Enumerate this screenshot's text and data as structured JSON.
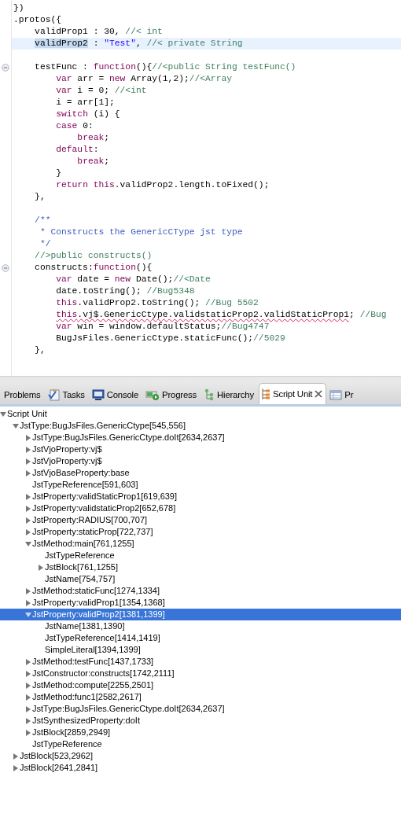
{
  "editor": {
    "lines": [
      {
        "kind": "flush",
        "fold": false,
        "highlighted": false,
        "tokens": [
          {
            "kind": "plain",
            "text": "})"
          }
        ]
      },
      {
        "kind": "flush",
        "fold": false,
        "highlighted": false,
        "tokens": [
          {
            "kind": "plain",
            "text": ".protos({"
          }
        ]
      },
      {
        "kind": "member",
        "fold": false,
        "highlighted": false,
        "tokens": [
          {
            "kind": "plain",
            "text": "validProp1 : 30, "
          },
          {
            "kind": "comment",
            "text": "//< int"
          }
        ]
      },
      {
        "kind": "member",
        "fold": false,
        "highlighted": true,
        "tokens": [
          {
            "kind": "selection",
            "text": "validProp2"
          },
          {
            "kind": "plain",
            "text": " : "
          },
          {
            "kind": "string",
            "text": "\"Test\""
          },
          {
            "kind": "plain",
            "text": ", "
          },
          {
            "kind": "comment",
            "text": "//< private String"
          }
        ]
      },
      {
        "kind": "blank"
      },
      {
        "kind": "member",
        "fold": true,
        "highlighted": false,
        "tokens": [
          {
            "kind": "plain",
            "text": "testFunc : "
          },
          {
            "kind": "keyword",
            "text": "function"
          },
          {
            "kind": "plain",
            "text": "(){"
          },
          {
            "kind": "comment",
            "text": "//<public String testFunc()"
          }
        ]
      },
      {
        "kind": "body",
        "fold": false,
        "highlighted": false,
        "tokens": [
          {
            "kind": "keyword",
            "text": "var"
          },
          {
            "kind": "plain",
            "text": " arr = "
          },
          {
            "kind": "keyword",
            "text": "new"
          },
          {
            "kind": "plain",
            "text": " Array(1,2);"
          },
          {
            "kind": "comment",
            "text": "//<Array"
          }
        ]
      },
      {
        "kind": "body",
        "fold": false,
        "highlighted": false,
        "tokens": [
          {
            "kind": "keyword",
            "text": "var"
          },
          {
            "kind": "plain",
            "text": " i = 0; "
          },
          {
            "kind": "comment",
            "text": "//<int"
          }
        ]
      },
      {
        "kind": "body",
        "fold": false,
        "highlighted": false,
        "tokens": [
          {
            "kind": "plain",
            "text": "i = arr[1];"
          }
        ]
      },
      {
        "kind": "body",
        "fold": false,
        "highlighted": false,
        "tokens": [
          {
            "kind": "keyword",
            "text": "switch"
          },
          {
            "kind": "plain",
            "text": " (i) {"
          }
        ]
      },
      {
        "kind": "body",
        "fold": false,
        "highlighted": false,
        "tokens": [
          {
            "kind": "keyword",
            "text": "case"
          },
          {
            "kind": "plain",
            "text": " 0:"
          }
        ]
      },
      {
        "kind": "nested",
        "fold": false,
        "highlighted": false,
        "tokens": [
          {
            "kind": "keyword",
            "text": "break"
          },
          {
            "kind": "plain",
            "text": ";"
          }
        ]
      },
      {
        "kind": "body",
        "fold": false,
        "highlighted": false,
        "tokens": [
          {
            "kind": "keyword",
            "text": "default"
          },
          {
            "kind": "plain",
            "text": ":"
          }
        ]
      },
      {
        "kind": "nested",
        "fold": false,
        "highlighted": false,
        "tokens": [
          {
            "kind": "keyword",
            "text": "break"
          },
          {
            "kind": "plain",
            "text": ";"
          }
        ]
      },
      {
        "kind": "body",
        "fold": false,
        "highlighted": false,
        "tokens": [
          {
            "kind": "plain",
            "text": "}"
          }
        ]
      },
      {
        "kind": "body",
        "fold": false,
        "highlighted": false,
        "tokens": [
          {
            "kind": "keyword",
            "text": "return this"
          },
          {
            "kind": "plain",
            "text": ".validProp2.length.toFixed();"
          }
        ]
      },
      {
        "kind": "member",
        "fold": false,
        "highlighted": false,
        "tokens": [
          {
            "kind": "plain",
            "text": "},"
          }
        ]
      },
      {
        "kind": "blank"
      },
      {
        "kind": "member",
        "fold": false,
        "highlighted": false,
        "tokens": [
          {
            "kind": "doc",
            "text": "/**"
          }
        ]
      },
      {
        "kind": "docbody",
        "fold": false,
        "highlighted": false,
        "tokens": [
          {
            "kind": "doc",
            "text": "* Constructs the GenericCType jst type"
          }
        ]
      },
      {
        "kind": "docbody",
        "fold": false,
        "highlighted": false,
        "tokens": [
          {
            "kind": "doc",
            "text": "*/"
          }
        ]
      },
      {
        "kind": "member",
        "fold": false,
        "highlighted": false,
        "tokens": [
          {
            "kind": "comment",
            "text": "//>public constructs()"
          }
        ]
      },
      {
        "kind": "member",
        "fold": true,
        "highlighted": false,
        "tokens": [
          {
            "kind": "plain",
            "text": "constructs:"
          },
          {
            "kind": "keyword",
            "text": "function"
          },
          {
            "kind": "plain",
            "text": "(){"
          }
        ]
      },
      {
        "kind": "body",
        "fold": false,
        "highlighted": false,
        "tokens": [
          {
            "kind": "keyword",
            "text": "var"
          },
          {
            "kind": "plain",
            "text": " date = "
          },
          {
            "kind": "keyword",
            "text": "new"
          },
          {
            "kind": "plain",
            "text": " Date();"
          },
          {
            "kind": "comment",
            "text": "//<Date"
          }
        ]
      },
      {
        "kind": "body",
        "fold": false,
        "highlighted": false,
        "tokens": [
          {
            "kind": "plain",
            "text": "date.toString(); "
          },
          {
            "kind": "comment",
            "text": "//Bug5348"
          }
        ]
      },
      {
        "kind": "body",
        "fold": false,
        "highlighted": false,
        "tokens": [
          {
            "kind": "keyword",
            "text": "this"
          },
          {
            "kind": "plain",
            "text": ".validProp2.toString(); "
          },
          {
            "kind": "comment",
            "text": "//Bug 5502"
          }
        ]
      },
      {
        "kind": "body",
        "fold": false,
        "highlighted": false,
        "tokens": [
          {
            "kind": "keyword",
            "text": "this",
            "error": true
          },
          {
            "kind": "plain",
            "text": ".vj$.GenericCtype.validstaticProp2.validStaticProp1",
            "error": true
          },
          {
            "kind": "plain",
            "text": "; "
          },
          {
            "kind": "comment",
            "text": "//Bug"
          }
        ]
      },
      {
        "kind": "body",
        "fold": false,
        "highlighted": false,
        "tokens": [
          {
            "kind": "keyword",
            "text": "var"
          },
          {
            "kind": "plain",
            "text": " win = window.defaultStatus;"
          },
          {
            "kind": "comment",
            "text": "//Bug4747"
          }
        ]
      },
      {
        "kind": "body",
        "fold": false,
        "highlighted": false,
        "tokens": [
          {
            "kind": "plain",
            "text": "BugJsFiles.GenericCtype.staticFunc();"
          },
          {
            "kind": "comment",
            "text": "//5029"
          }
        ]
      },
      {
        "kind": "member",
        "fold": false,
        "highlighted": false,
        "tokens": [
          {
            "kind": "plain",
            "text": "},"
          }
        ]
      }
    ]
  },
  "panel": {
    "tabs": [
      {
        "label": "Problems",
        "selected": false
      },
      {
        "label": "Tasks",
        "selected": false
      },
      {
        "label": "Console",
        "selected": false
      },
      {
        "label": "Progress",
        "selected": false
      },
      {
        "label": "Hierarchy",
        "selected": false
      },
      {
        "label": "Script Unit",
        "selected": true
      },
      {
        "label": "Pr",
        "selected": false
      }
    ],
    "tree": [
      {
        "label": "Script Unit",
        "kind": "branch",
        "expanded": true,
        "selected": false,
        "children": [
          {
            "label": "JstType:BugJsFiles.GenericCtype[545,556]",
            "kind": "branch",
            "expanded": true,
            "selected": false,
            "children": [
              {
                "label": "JstType:BugJsFiles.GenericCtype.doIt[2634,2637]",
                "kind": "branch",
                "expanded": false,
                "selected": false
              },
              {
                "label": "JstVjoProperty:vj$",
                "kind": "branch",
                "expanded": false,
                "selected": false
              },
              {
                "label": "JstVjoProperty:vj$",
                "kind": "branch",
                "expanded": false,
                "selected": false
              },
              {
                "label": "JstVjoBaseProperty:base",
                "kind": "branch",
                "expanded": false,
                "selected": false
              },
              {
                "label": "JstTypeReference[591,603]",
                "kind": "leaf",
                "selected": false
              },
              {
                "label": "JstProperty:validStaticProp1[619,639]",
                "kind": "branch",
                "expanded": false,
                "selected": false
              },
              {
                "label": "JstProperty:validstaticProp2[652,678]",
                "kind": "branch",
                "expanded": false,
                "selected": false
              },
              {
                "label": "JstProperty:RADIUS[700,707]",
                "kind": "branch",
                "expanded": false,
                "selected": false
              },
              {
                "label": "JstProperty:staticProp[722,737]",
                "kind": "branch",
                "expanded": false,
                "selected": false
              },
              {
                "label": "JstMethod:main[761,1255]",
                "kind": "branch",
                "expanded": true,
                "selected": false,
                "children": [
                  {
                    "label": "JstTypeReference",
                    "kind": "leaf",
                    "selected": false
                  },
                  {
                    "label": "JstBlock[761,1255]",
                    "kind": "branch",
                    "expanded": false,
                    "selected": false
                  },
                  {
                    "label": "JstName[754,757]",
                    "kind": "leaf",
                    "selected": false
                  }
                ]
              },
              {
                "label": "JstMethod:staticFunc[1274,1334]",
                "kind": "branch",
                "expanded": false,
                "selected": false
              },
              {
                "label": "JstProperty:validProp1[1354,1368]",
                "kind": "branch",
                "expanded": false,
                "selected": false
              },
              {
                "label": "JstProperty:validProp2[1381,1399]",
                "kind": "branch",
                "expanded": true,
                "selected": true,
                "children": [
                  {
                    "label": "JstName[1381,1390]",
                    "kind": "leaf",
                    "selected": false
                  },
                  {
                    "label": "JstTypeReference[1414,1419]",
                    "kind": "leaf",
                    "selected": false
                  },
                  {
                    "label": "SimpleLiteral[1394,1399]",
                    "kind": "leaf",
                    "selected": false
                  }
                ]
              },
              {
                "label": "JstMethod:testFunc[1437,1733]",
                "kind": "branch",
                "expanded": false,
                "selected": false
              },
              {
                "label": "JstConstructor:constructs[1742,2111]",
                "kind": "branch",
                "expanded": false,
                "selected": false
              },
              {
                "label": "JstMethod:compute[2255,2501]",
                "kind": "branch",
                "expanded": false,
                "selected": false
              },
              {
                "label": "JstMethod:func1[2582,2617]",
                "kind": "branch",
                "expanded": false,
                "selected": false
              },
              {
                "label": "JstType:BugJsFiles.GenericCtype.doIt[2634,2637]",
                "kind": "branch",
                "expanded": false,
                "selected": false
              },
              {
                "label": "JstSynthesizedProperty:doIt",
                "kind": "branch",
                "expanded": false,
                "selected": false
              },
              {
                "label": "JstBlock[2859,2949]",
                "kind": "branch",
                "expanded": false,
                "selected": false
              },
              {
                "label": "JstTypeReference",
                "kind": "leaf",
                "selected": false
              }
            ]
          },
          {
            "label": "JstBlock[523,2962]",
            "kind": "branch",
            "expanded": false,
            "selected": false
          },
          {
            "label": "JstBlock[2641,2841]",
            "kind": "branch",
            "expanded": false,
            "selected": false
          }
        ]
      }
    ]
  }
}
